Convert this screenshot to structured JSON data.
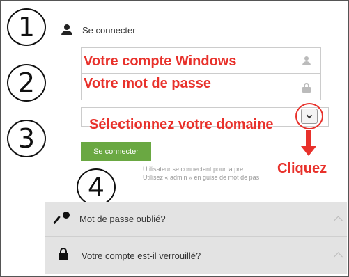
{
  "login": {
    "title": "Se connecter",
    "username_placeholder": "Votre compte Windows",
    "password_placeholder": "Votre mot de passe",
    "domain_placeholder": "Sélectionnez votre domaine",
    "submit_label": "Se connecter",
    "hint_line1": "Utilisateur se connectant pour la pre",
    "hint_line2": "Utilisez « admin » en guise de mot de pas"
  },
  "annotations": {
    "steps": [
      "1",
      "2",
      "3",
      "4"
    ],
    "click_label": "Cliquez",
    "color": "#e8312b"
  },
  "accordion": [
    {
      "label": "Mot de passe oublié?",
      "icon": "key-icon"
    },
    {
      "label": "Votre compte est-il verrouillé?",
      "icon": "lock-icon"
    }
  ],
  "colors": {
    "submit_button": "#6aa842",
    "accordion_bg": "#e3e3e3"
  }
}
